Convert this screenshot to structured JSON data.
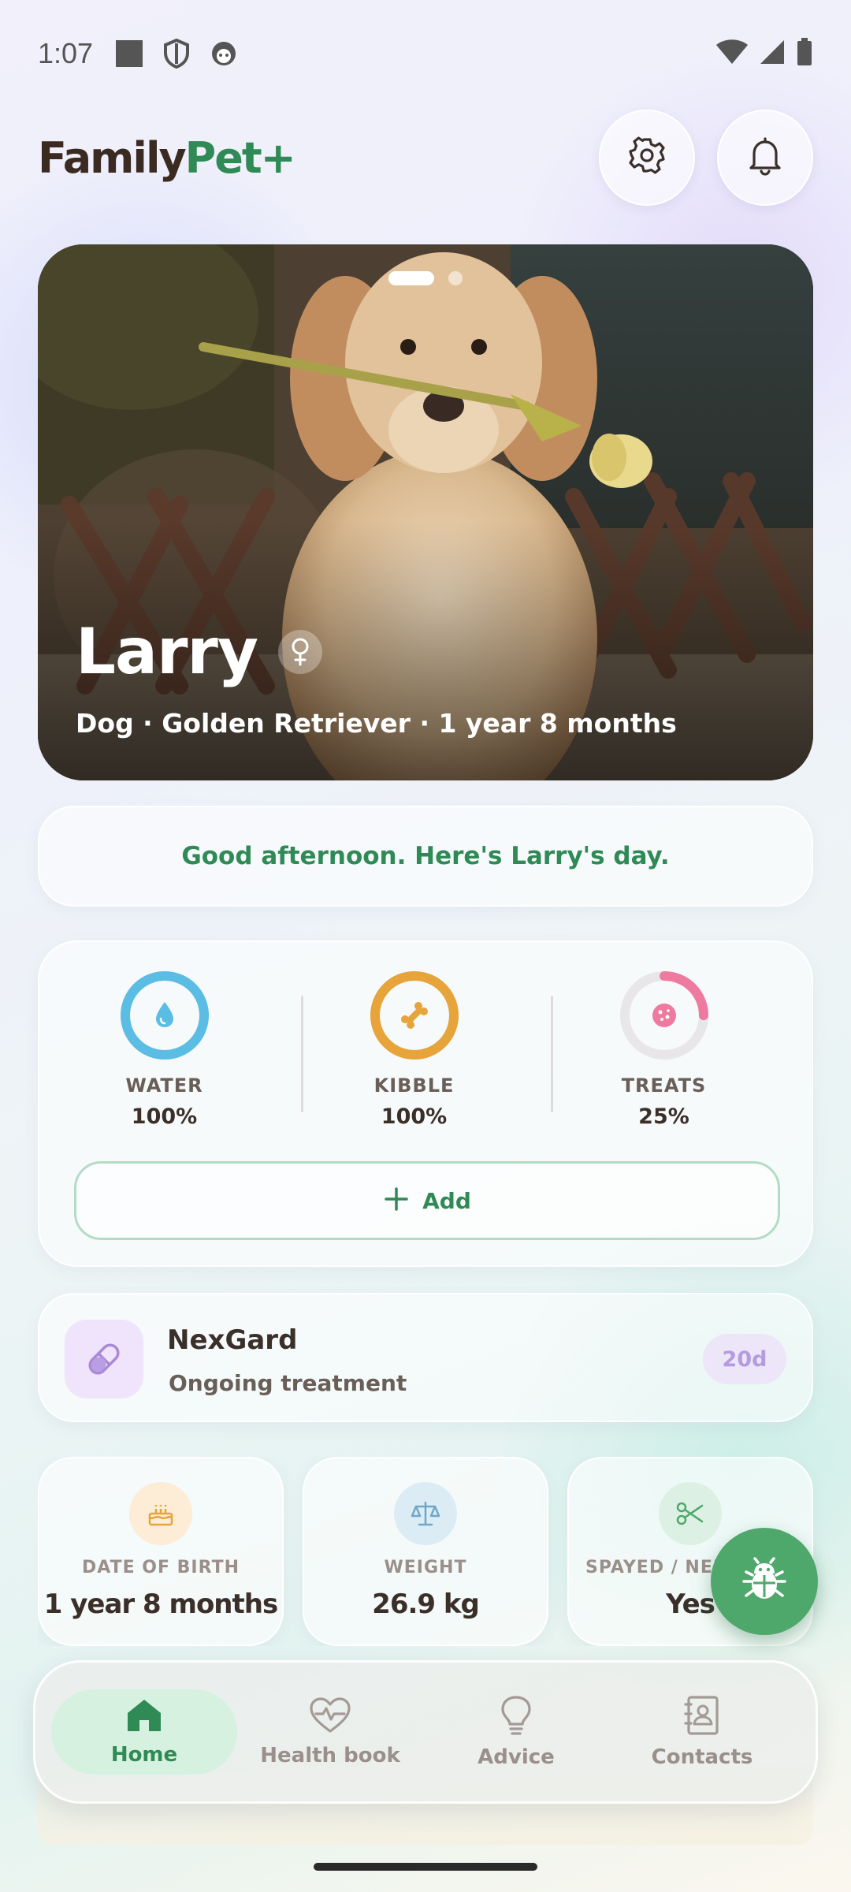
{
  "status_bar": {
    "time": "1:07"
  },
  "header": {
    "brand_part1": "Family",
    "brand_part2": "Pet+"
  },
  "hero": {
    "pet_name": "Larry",
    "subtitle": "Dog · Golden Retriever · 1 year 8 months",
    "carousel_active_index": 0,
    "carousel_count": 2
  },
  "greeting": "Good afternoon. Here's Larry's day.",
  "intake": [
    {
      "label": "WATER",
      "value": "100%",
      "level": 1.0,
      "color": "#5bbde3",
      "icon": "water-drop-icon"
    },
    {
      "label": "KIBBLE",
      "value": "100%",
      "level": 1.0,
      "color": "#e6a43a",
      "icon": "bone-icon"
    },
    {
      "label": "TREATS",
      "value": "25%",
      "level": 0.25,
      "color": "#ee7aa0",
      "icon": "cookie-icon"
    }
  ],
  "add_button": {
    "label": "Add"
  },
  "treatment": {
    "title": "NexGard",
    "subtitle": "Ongoing treatment",
    "days": "20d"
  },
  "info_tiles": [
    {
      "label": "DATE OF BIRTH",
      "value": "1 year 8 months",
      "icon": "cake-icon"
    },
    {
      "label": "WEIGHT",
      "value": "26.9 kg",
      "icon": "scale-icon"
    },
    {
      "label": "SPAYED / NEUTERED",
      "value": "Yes",
      "icon": "scissors-icon"
    }
  ],
  "bottom_nav": [
    {
      "label": "Home",
      "icon": "home-icon",
      "active": true
    },
    {
      "label": "Health book",
      "icon": "heart-pulse-icon",
      "active": false
    },
    {
      "label": "Advice",
      "icon": "lightbulb-icon",
      "active": false
    },
    {
      "label": "Contacts",
      "icon": "contacts-icon",
      "active": false
    }
  ],
  "colors": {
    "brand_green": "#2f8a55",
    "fab_green": "#4ea86b",
    "accent_purple": "#b59be0"
  }
}
